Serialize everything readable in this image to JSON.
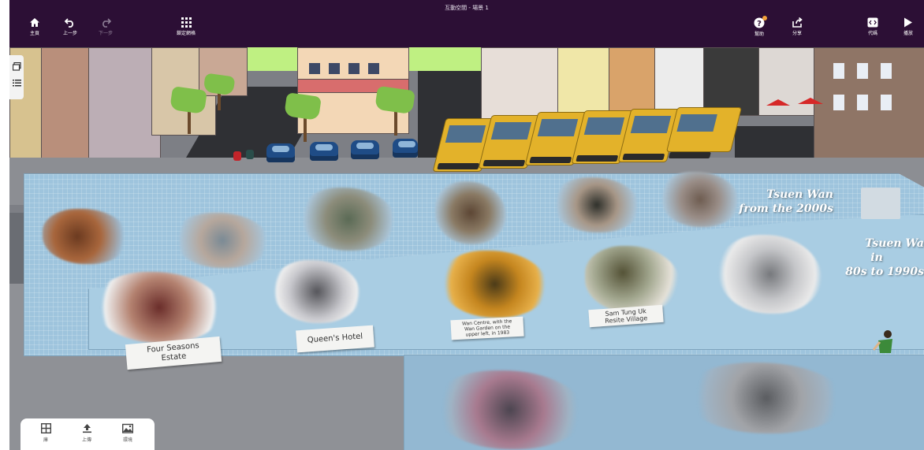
{
  "toolbar": {
    "doc_title": "互動空間 - 場景 1",
    "items": [
      {
        "label": "主頁",
        "icon": "home-icon"
      },
      {
        "label": "上一步",
        "icon": "undo-icon"
      },
      {
        "label": "下一步",
        "icon": "redo-icon"
      },
      {
        "label": "鎖定網格",
        "icon": "grid-icon"
      }
    ],
    "right_items": [
      {
        "label": "幫助",
        "icon": "help-icon"
      },
      {
        "label": "分享",
        "icon": "share-icon"
      },
      {
        "label": "代碼",
        "icon": "code-icon"
      },
      {
        "label": "播放",
        "icon": "play-icon"
      }
    ]
  },
  "sidepanel": {
    "icons": [
      "layers-icon",
      "list-icon"
    ]
  },
  "bottombar": {
    "items": [
      {
        "label": "庫",
        "icon": "library-icon"
      },
      {
        "label": "上傳",
        "icon": "upload-icon"
      },
      {
        "label": "環境",
        "icon": "environment-icon"
      }
    ]
  },
  "exhibit": {
    "wall_title_1": [
      "Tsuen Wan",
      "from the 2000s"
    ],
    "wall_title_2": [
      "Tsuen Wa",
      "in",
      "80s to 1990s"
    ],
    "captions": {
      "four_seasons": [
        "Four Seasons",
        "Estate"
      ],
      "queens": [
        "Queen's Hotel"
      ],
      "wan_centre": [
        "Wan Centre, with the",
        "Wan Garden on the",
        "upper left, in 1983"
      ],
      "sam_tung": [
        "Sam Tung Uk",
        "Resite Village"
      ]
    }
  },
  "colors": {
    "toolbar_bg": "#2c0f35",
    "wall": "#9ec4dd",
    "bus": "#e3b22a",
    "car": "#1f4c86"
  }
}
